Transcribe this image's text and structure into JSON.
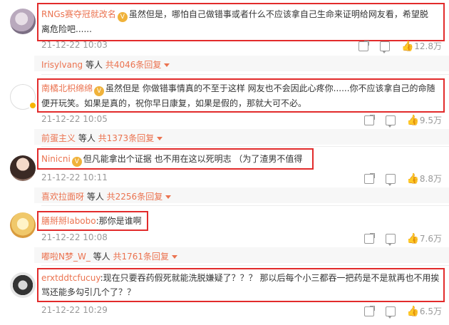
{
  "comments": [
    {
      "username": "RNGs赛夺冠就改名",
      "text": "虽然但是，哪怕自己做错事或者什么不应该拿自己生命来证明给网友看，希望脱离危险吧......",
      "text_line1": "虽然但是，哪怕自己做错事或者什么不应该拿自己生命来证明给网友看，希望脱",
      "text_line2": "离危险吧......",
      "time": "21-12-22 10:03",
      "likes": "12.8万",
      "reply_user": "Irisylvang",
      "reply_mid": " 等人 ",
      "reply_count": "共4046条回复"
    },
    {
      "username": "南橘北枳绵绵",
      "text_line1": "虽然但是 你做错事情真的不至于这样 网友也不会因此心疼你......你不应该拿自己的命随",
      "text_line2": "便开玩笑。如果是真的，祝你早日康复，如果是假的，那就大可不必。",
      "time": "21-12-22 10:05",
      "likes": "9.5万",
      "reply_user": "前蛋主义",
      "reply_mid": " 等人 ",
      "reply_count": "共1373条回复"
    },
    {
      "username": "Ninicni",
      "text_line1": "但凡能拿出个证据 也不用在这以死明志 （为了渣男不值得",
      "time": "21-12-22 10:11",
      "likes": "8.8万",
      "reply_user": "喜欢拉面呀",
      "reply_mid": " 等人 ",
      "reply_count": "共2256条回复"
    },
    {
      "username": "膳掰掰labobo",
      "text_line1": "那你是谁啊",
      "time": "21-12-22 10:08",
      "likes": "7.6万",
      "reply_user": "嘟啦N梦_W_",
      "reply_mid": " 等人 ",
      "reply_count": "共1761条回复"
    },
    {
      "username": "erxtddtcfucuy",
      "text_line1": "现在只要吞药假死就能洗脱嫌疑了？？？ 那以后每个小三都吞一把药是不是就再也不用挨",
      "text_line2": "骂还能多勾引几个了？？",
      "time": "21-12-22 10:29",
      "likes": "6.5万"
    }
  ],
  "medal_label": "V",
  "like_icon": "thumbs-up-icon",
  "colors": {
    "username": "#eb7350",
    "highlight_box": "#e22b2b",
    "meta": "#999999"
  }
}
